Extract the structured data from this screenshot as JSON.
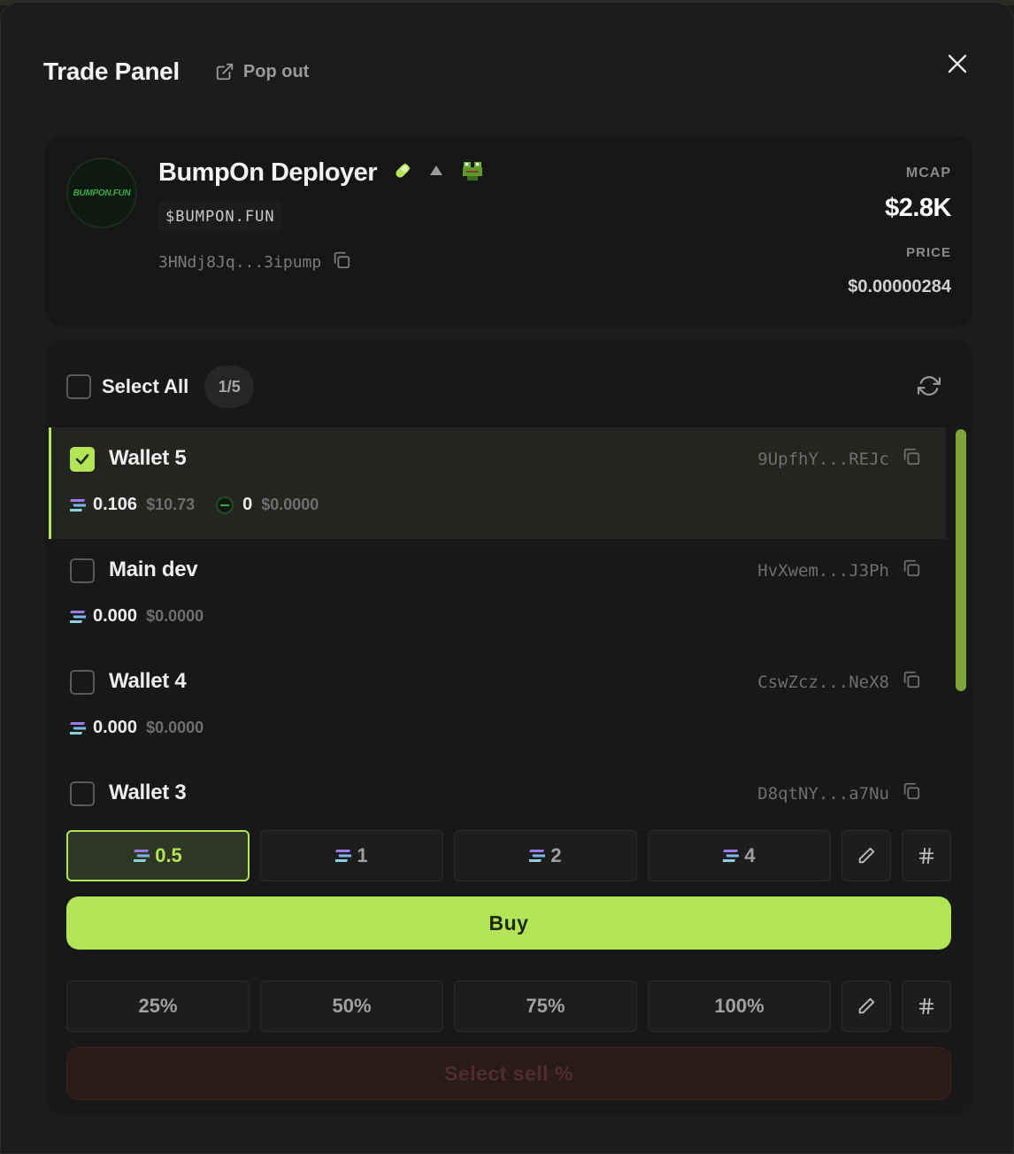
{
  "header": {
    "title": "Trade Panel",
    "popout_label": "Pop out"
  },
  "token": {
    "logo_text": "BUMPON.FUN",
    "name": "BumpOn Deployer",
    "ticker": "$BUMPON.FUN",
    "contract": "3HNdj8Jq...3ipump",
    "mcap_label": "MCAP",
    "mcap_value": "$2.8K",
    "price_label": "PRICE",
    "price_value": "$0.00000284"
  },
  "selection": {
    "select_all_label": "Select All",
    "count": "1/5"
  },
  "wallets": [
    {
      "name": "Wallet 5",
      "address": "9UpfhY...REJc",
      "sol": "0.106",
      "sol_usd": "$10.73",
      "token": "0",
      "token_usd": "$0.0000",
      "selected": true
    },
    {
      "name": "Main dev",
      "address": "HvXwem...J3Ph",
      "sol": "0.000",
      "sol_usd": "$0.0000",
      "selected": false
    },
    {
      "name": "Wallet 4",
      "address": "CswZcz...NeX8",
      "sol": "0.000",
      "sol_usd": "$0.0000",
      "selected": false
    },
    {
      "name": "Wallet 3",
      "address": "D8qtNY...a7Nu",
      "sol": "",
      "sol_usd": "",
      "selected": false
    }
  ],
  "buy_amounts": [
    {
      "label": "0.5",
      "active": true
    },
    {
      "label": "1",
      "active": false
    },
    {
      "label": "2",
      "active": false
    },
    {
      "label": "4",
      "active": false
    }
  ],
  "buy_label": "Buy",
  "sell_percents": [
    "25%",
    "50%",
    "75%",
    "100%"
  ],
  "sell_label": "Select sell %",
  "colors": {
    "accent": "#b3e356",
    "background": "#1c1c1c",
    "sell_disabled": "#2a1a18"
  },
  "icons": {
    "popout": "external-link-icon",
    "close": "close-icon",
    "pill": "pill-icon",
    "triangle": "triangle-icon",
    "pepe": "frog-icon",
    "copy": "copy-icon",
    "refresh": "refresh-icon",
    "sol": "solana-icon",
    "edit": "pencil-icon",
    "hash": "hash-icon"
  }
}
